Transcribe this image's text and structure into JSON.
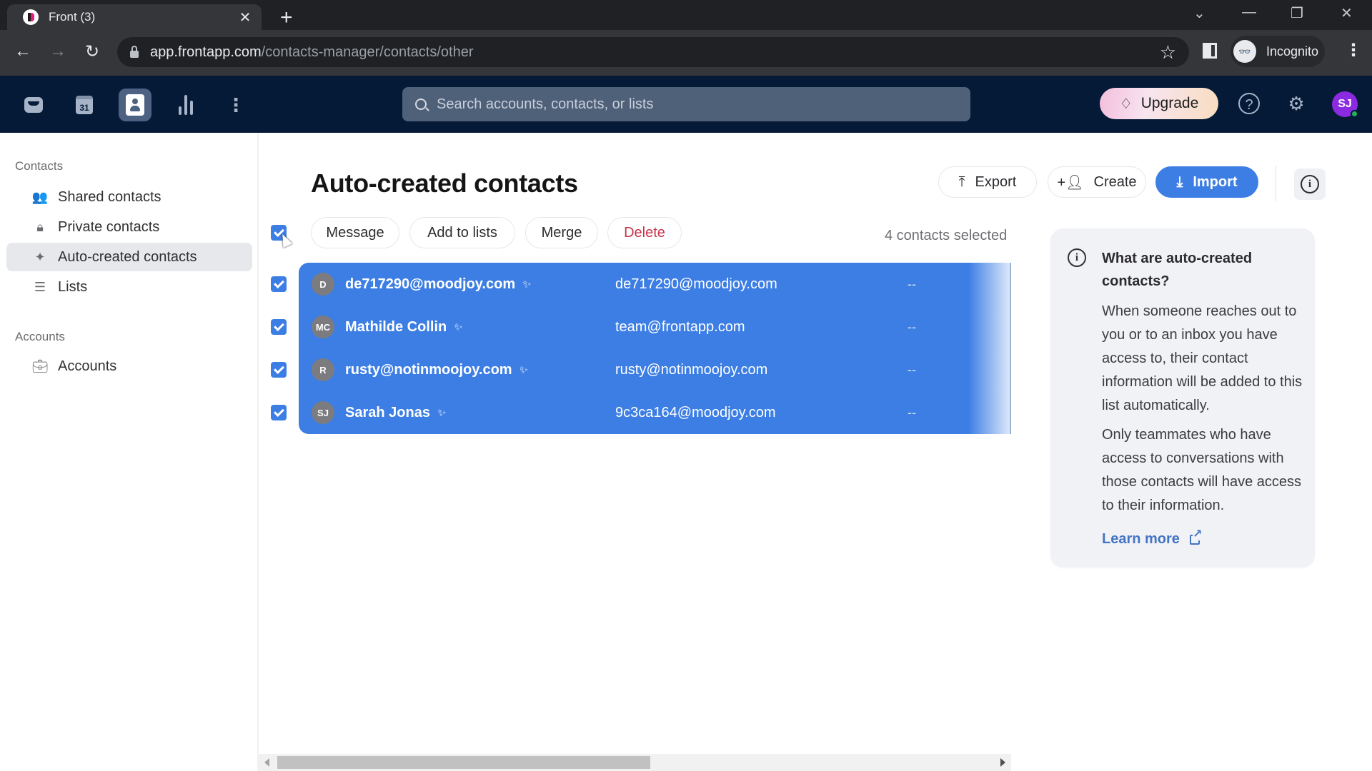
{
  "browser": {
    "tab_title": "Front (3)",
    "url_domain": "app.frontapp.com",
    "url_path": "/contacts-manager/contacts/other",
    "profile_label": "Incognito"
  },
  "app_header": {
    "nav_icons": [
      "inbox-icon",
      "calendar-icon",
      "contacts-icon",
      "analytics-icon",
      "more-icon"
    ],
    "calendar_day": "31",
    "search_placeholder": "Search accounts, contacts, or lists",
    "upgrade_label": "Upgrade",
    "user_initials": "SJ",
    "accent_color": "#3c7ee4"
  },
  "sidebar": {
    "contacts_section": "Contacts",
    "contacts_items": [
      {
        "label": "Shared contacts",
        "icon": "shared-contacts-icon"
      },
      {
        "label": "Private contacts",
        "icon": "lock-icon"
      },
      {
        "label": "Auto-created contacts",
        "icon": "sparkle-icon",
        "active": true
      },
      {
        "label": "Lists",
        "icon": "list-icon"
      }
    ],
    "accounts_section": "Accounts",
    "accounts_items": [
      {
        "label": "Accounts",
        "icon": "briefcase-icon"
      }
    ]
  },
  "main": {
    "title": "Auto-created contacts",
    "header_buttons": {
      "export": "Export",
      "create": "Create",
      "import": "Import"
    },
    "bulk_actions": {
      "message": "Message",
      "add_to_lists": "Add to lists",
      "merge": "Merge",
      "delete": "Delete"
    },
    "selection_status": "4 contacts selected",
    "contacts": [
      {
        "initials": "D",
        "name": "de717290@moodjoy.com",
        "email": "de717290@moodjoy.com",
        "extra": "--",
        "selected": true
      },
      {
        "initials": "MC",
        "name": "Mathilde Collin",
        "email": "team@frontapp.com",
        "extra": "--",
        "selected": true
      },
      {
        "initials": "R",
        "name": "rusty@notinmoojoy.com",
        "email": "rusty@notinmoojoy.com",
        "extra": "--",
        "selected": true
      },
      {
        "initials": "SJ",
        "name": "Sarah Jonas",
        "email": "9c3ca164@moodjoy.com",
        "extra": "--",
        "selected": true
      }
    ]
  },
  "help_panel": {
    "title": "What are auto-created contacts?",
    "paragraph1": "When someone reaches out to you or to an inbox you have access to, their contact information will be added to this list automatically.",
    "paragraph2": "Only teammates who have access to conversations with those contacts will have access to their information.",
    "link_label": "Learn more"
  }
}
